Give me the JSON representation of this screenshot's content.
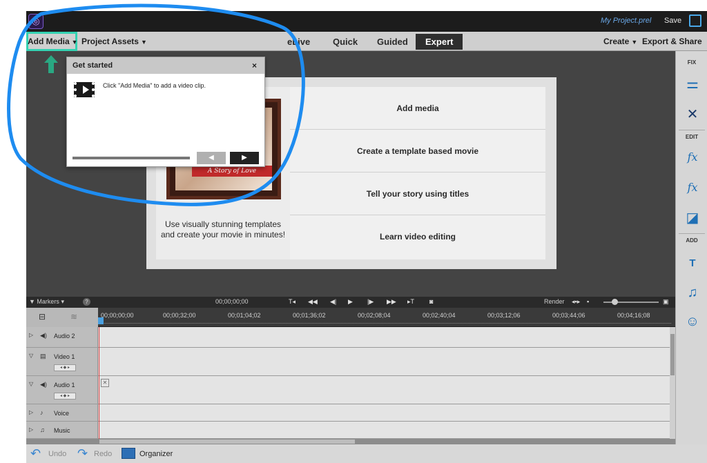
{
  "title_bar": {
    "project_name": "My Project.prel",
    "save_label": "Save"
  },
  "menu": {
    "add_media": "Add Media",
    "project_assets": "Project Assets",
    "mode_tabs": [
      "eLive",
      "Quick",
      "Guided",
      "Expert"
    ],
    "active_tab": "Expert",
    "create": "Create",
    "export_share": "Export & Share"
  },
  "popup": {
    "title": "Get started",
    "close": "×",
    "message": "Click \"Add Media\" to add a video clip.",
    "prev": "◀",
    "next": "▶"
  },
  "welcome": {
    "photo_caption": "A Story of Love",
    "description": "Use visually stunning templates and create your movie in minutes!",
    "options": [
      "Add media",
      "Create a template based movie",
      "Tell your story using titles",
      "Learn video editing"
    ]
  },
  "right_panel": {
    "fix_label": "FIX",
    "edit_label": "EDIT",
    "add_label": "ADD"
  },
  "timeline": {
    "markers_label": "Markers",
    "help": "?",
    "current_time": "00;00;00;00",
    "render_label": "Render",
    "ruler": [
      "00;00;00;00",
      "00;00;32;00",
      "00;01;04;02",
      "00;01;36;02",
      "00;02;08;04",
      "00;02;40;04",
      "00;03;12;06",
      "00;03;44;06",
      "00;04;16;08"
    ],
    "tracks": [
      "Audio 2",
      "Video 1",
      "Audio 1",
      "Voice",
      "Music"
    ]
  },
  "bottom_bar": {
    "undo": "Undo",
    "redo": "Redo",
    "organizer": "Organizer"
  },
  "colors": {
    "highlight": "#34d2b2",
    "annotation": "#1e8cf0",
    "accent": "#1e6fb5"
  },
  "icons": [
    "app-logo-icon",
    "fullscreen-icon",
    "film-icon",
    "adjust-icon",
    "tools-icon",
    "fx-edit-icon",
    "fx-icon",
    "color-icon",
    "title-icon",
    "music-icon",
    "graphics-icon",
    "undo-icon",
    "redo-icon",
    "organizer-icon"
  ]
}
